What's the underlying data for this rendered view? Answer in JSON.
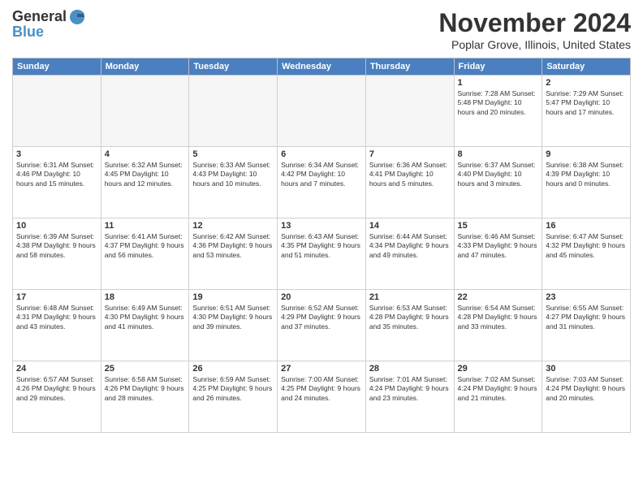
{
  "header": {
    "logo_general": "General",
    "logo_blue": "Blue",
    "main_title": "November 2024",
    "subtitle": "Poplar Grove, Illinois, United States"
  },
  "weekdays": [
    "Sunday",
    "Monday",
    "Tuesday",
    "Wednesday",
    "Thursday",
    "Friday",
    "Saturday"
  ],
  "weeks": [
    [
      {
        "day": "",
        "info": ""
      },
      {
        "day": "",
        "info": ""
      },
      {
        "day": "",
        "info": ""
      },
      {
        "day": "",
        "info": ""
      },
      {
        "day": "",
        "info": ""
      },
      {
        "day": "1",
        "info": "Sunrise: 7:28 AM\nSunset: 5:48 PM\nDaylight: 10 hours\nand 20 minutes."
      },
      {
        "day": "2",
        "info": "Sunrise: 7:29 AM\nSunset: 5:47 PM\nDaylight: 10 hours\nand 17 minutes."
      }
    ],
    [
      {
        "day": "3",
        "info": "Sunrise: 6:31 AM\nSunset: 4:46 PM\nDaylight: 10 hours\nand 15 minutes."
      },
      {
        "day": "4",
        "info": "Sunrise: 6:32 AM\nSunset: 4:45 PM\nDaylight: 10 hours\nand 12 minutes."
      },
      {
        "day": "5",
        "info": "Sunrise: 6:33 AM\nSunset: 4:43 PM\nDaylight: 10 hours\nand 10 minutes."
      },
      {
        "day": "6",
        "info": "Sunrise: 6:34 AM\nSunset: 4:42 PM\nDaylight: 10 hours\nand 7 minutes."
      },
      {
        "day": "7",
        "info": "Sunrise: 6:36 AM\nSunset: 4:41 PM\nDaylight: 10 hours\nand 5 minutes."
      },
      {
        "day": "8",
        "info": "Sunrise: 6:37 AM\nSunset: 4:40 PM\nDaylight: 10 hours\nand 3 minutes."
      },
      {
        "day": "9",
        "info": "Sunrise: 6:38 AM\nSunset: 4:39 PM\nDaylight: 10 hours\nand 0 minutes."
      }
    ],
    [
      {
        "day": "10",
        "info": "Sunrise: 6:39 AM\nSunset: 4:38 PM\nDaylight: 9 hours\nand 58 minutes."
      },
      {
        "day": "11",
        "info": "Sunrise: 6:41 AM\nSunset: 4:37 PM\nDaylight: 9 hours\nand 56 minutes."
      },
      {
        "day": "12",
        "info": "Sunrise: 6:42 AM\nSunset: 4:36 PM\nDaylight: 9 hours\nand 53 minutes."
      },
      {
        "day": "13",
        "info": "Sunrise: 6:43 AM\nSunset: 4:35 PM\nDaylight: 9 hours\nand 51 minutes."
      },
      {
        "day": "14",
        "info": "Sunrise: 6:44 AM\nSunset: 4:34 PM\nDaylight: 9 hours\nand 49 minutes."
      },
      {
        "day": "15",
        "info": "Sunrise: 6:46 AM\nSunset: 4:33 PM\nDaylight: 9 hours\nand 47 minutes."
      },
      {
        "day": "16",
        "info": "Sunrise: 6:47 AM\nSunset: 4:32 PM\nDaylight: 9 hours\nand 45 minutes."
      }
    ],
    [
      {
        "day": "17",
        "info": "Sunrise: 6:48 AM\nSunset: 4:31 PM\nDaylight: 9 hours\nand 43 minutes."
      },
      {
        "day": "18",
        "info": "Sunrise: 6:49 AM\nSunset: 4:30 PM\nDaylight: 9 hours\nand 41 minutes."
      },
      {
        "day": "19",
        "info": "Sunrise: 6:51 AM\nSunset: 4:30 PM\nDaylight: 9 hours\nand 39 minutes."
      },
      {
        "day": "20",
        "info": "Sunrise: 6:52 AM\nSunset: 4:29 PM\nDaylight: 9 hours\nand 37 minutes."
      },
      {
        "day": "21",
        "info": "Sunrise: 6:53 AM\nSunset: 4:28 PM\nDaylight: 9 hours\nand 35 minutes."
      },
      {
        "day": "22",
        "info": "Sunrise: 6:54 AM\nSunset: 4:28 PM\nDaylight: 9 hours\nand 33 minutes."
      },
      {
        "day": "23",
        "info": "Sunrise: 6:55 AM\nSunset: 4:27 PM\nDaylight: 9 hours\nand 31 minutes."
      }
    ],
    [
      {
        "day": "24",
        "info": "Sunrise: 6:57 AM\nSunset: 4:26 PM\nDaylight: 9 hours\nand 29 minutes."
      },
      {
        "day": "25",
        "info": "Sunrise: 6:58 AM\nSunset: 4:26 PM\nDaylight: 9 hours\nand 28 minutes."
      },
      {
        "day": "26",
        "info": "Sunrise: 6:59 AM\nSunset: 4:25 PM\nDaylight: 9 hours\nand 26 minutes."
      },
      {
        "day": "27",
        "info": "Sunrise: 7:00 AM\nSunset: 4:25 PM\nDaylight: 9 hours\nand 24 minutes."
      },
      {
        "day": "28",
        "info": "Sunrise: 7:01 AM\nSunset: 4:24 PM\nDaylight: 9 hours\nand 23 minutes."
      },
      {
        "day": "29",
        "info": "Sunrise: 7:02 AM\nSunset: 4:24 PM\nDaylight: 9 hours\nand 21 minutes."
      },
      {
        "day": "30",
        "info": "Sunrise: 7:03 AM\nSunset: 4:24 PM\nDaylight: 9 hours\nand 20 minutes."
      }
    ]
  ]
}
